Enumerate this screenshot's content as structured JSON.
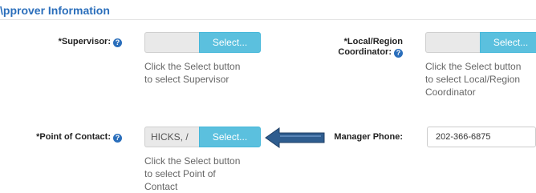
{
  "section": {
    "title": "\\pprover Information"
  },
  "supervisor": {
    "label": "*Supervisor:",
    "value": "",
    "button": "Select...",
    "hint_line1": "Click the Select button",
    "hint_line2": "to select Supervisor"
  },
  "coordinator": {
    "label_line1": "*Local/Region",
    "label_line2": "Coordinator:",
    "value": "",
    "button": "Select...",
    "hint_line1": "Click the Select button",
    "hint_line2": "to select Local/Region",
    "hint_line3": "Coordinator"
  },
  "point_of_contact": {
    "label": "*Point of Contact:",
    "value": "HICKS, /",
    "button": "Select...",
    "hint_line1": "Click the Select button",
    "hint_line2": "to select Point of",
    "hint_line3": "Contact"
  },
  "manager_phone": {
    "label": "Manager Phone:",
    "value": "202-366-6875"
  },
  "help_glyph": "?",
  "colors": {
    "accent": "#2a6ebb",
    "select_button": "#5bc0de",
    "arrow": "#2f5d8f"
  }
}
